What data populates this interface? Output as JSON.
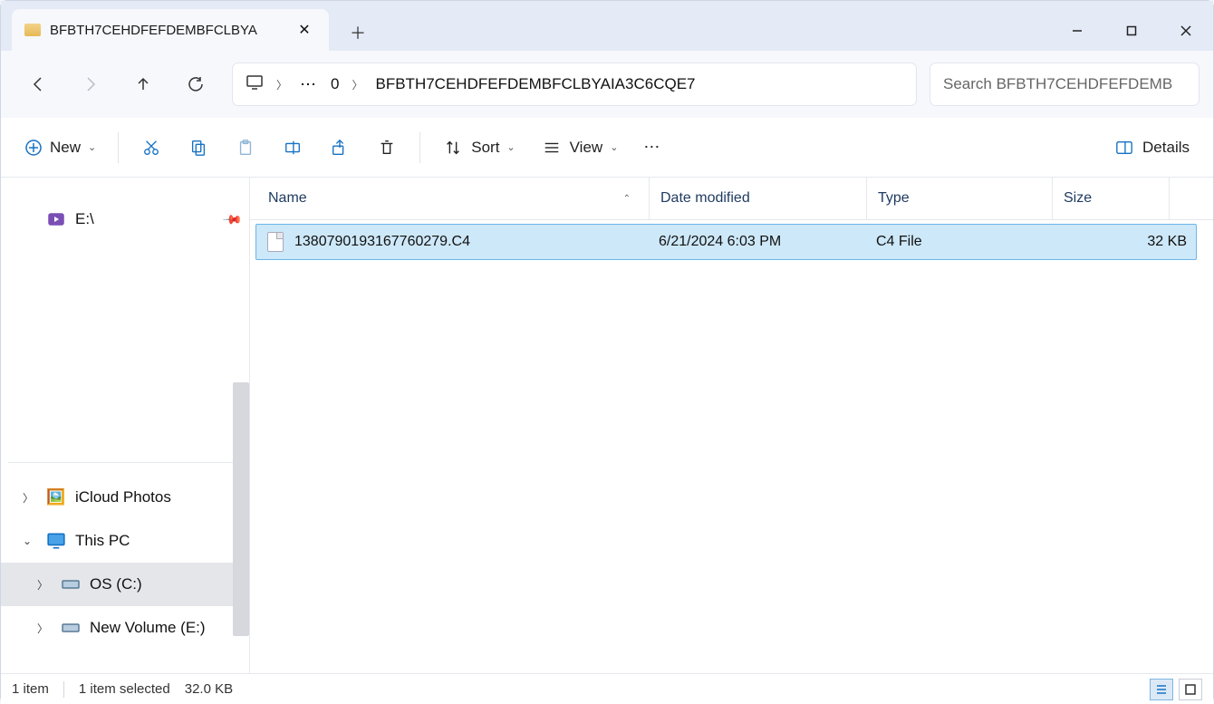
{
  "tab": {
    "title": "BFBTH7CEHDFEFDEMBFCLBYA"
  },
  "address": {
    "local": "0",
    "folder": "BFBTH7CEHDFEFDEMBFCLBYAIA3C6CQE7"
  },
  "search": {
    "placeholder": "Search BFBTH7CEHDFEFDEMB"
  },
  "toolbar": {
    "new": "New",
    "sort": "Sort",
    "view": "View",
    "details": "Details"
  },
  "columns": {
    "name": "Name",
    "date": "Date modified",
    "type": "Type",
    "size": "Size"
  },
  "sidebar": {
    "e_drive": "E:\\",
    "icloud": "iCloud Photos",
    "this_pc": "This PC",
    "os_c": "OS (C:)",
    "new_vol": "New Volume (E:)"
  },
  "file": {
    "name": "1380790193167760279.C4",
    "date": "6/21/2024 6:03 PM",
    "type": "C4 File",
    "size": "32 KB"
  },
  "status": {
    "count": "1 item",
    "selected": "1 item selected",
    "size": "32.0 KB"
  }
}
